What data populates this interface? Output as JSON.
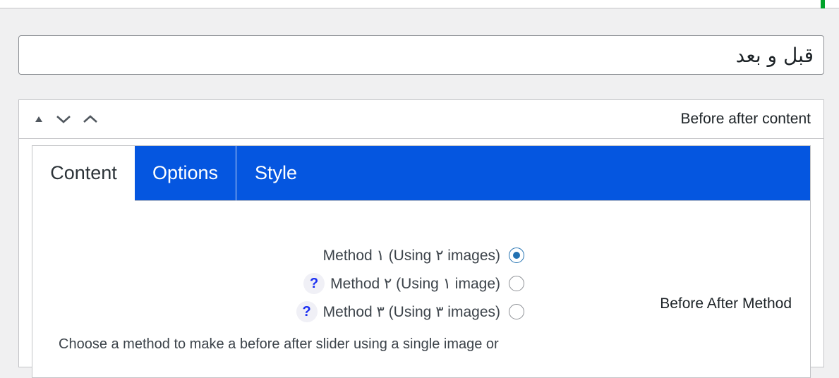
{
  "title_field": {
    "value": "قبل و بعد"
  },
  "postbox": {
    "title": "Before after content",
    "handle_icons": [
      "triangle-up-icon",
      "chevron-down-icon",
      "chevron-up-icon"
    ]
  },
  "tabs": [
    {
      "label": "Content",
      "active": true
    },
    {
      "label": "Options",
      "active": false
    },
    {
      "label": "Style",
      "active": false
    }
  ],
  "method_field": {
    "label": "Before After Method",
    "options": [
      {
        "label": "Method ١ (Using ٢ images)",
        "checked": true,
        "help": ""
      },
      {
        "label": "Method ٢ (Using ١ image)",
        "checked": false,
        "help": "?"
      },
      {
        "label": "Method ٣ (Using ٣ images)",
        "checked": false,
        "help": "?"
      }
    ],
    "description": "Choose a method to make a before after slider using a single image or"
  },
  "colors": {
    "tab_active_bg": "#0556e0",
    "accent_green": "#00a32a",
    "radio_checked": "#2271b1"
  }
}
